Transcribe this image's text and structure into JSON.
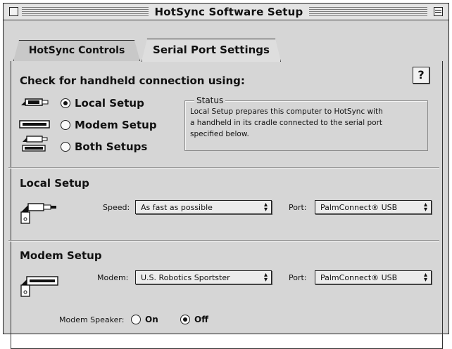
{
  "window": {
    "title": "HotSync Software Setup"
  },
  "tabs": [
    {
      "label": "HotSync Controls"
    },
    {
      "label": "Serial Port Settings"
    }
  ],
  "connection": {
    "heading": "Check for handheld connection using:",
    "help_label": "?",
    "options": [
      {
        "label": "Local Setup",
        "selected": true
      },
      {
        "label": "Modem Setup",
        "selected": false
      },
      {
        "label": "Both Setups",
        "selected": false
      }
    ],
    "status": {
      "title": "Status",
      "line1": "Local Setup prepares this computer to HotSync with",
      "line2": "a handheld in its cradle connected to the serial port",
      "line3": "specified below."
    }
  },
  "local_setup": {
    "heading": "Local Setup",
    "speed_label": "Speed:",
    "speed_value": "As fast as possible",
    "port_label": "Port:",
    "port_value": "PalmConnect® USB"
  },
  "modem_setup": {
    "heading": "Modem Setup",
    "modem_label": "Modem:",
    "modem_value": "U.S. Robotics Sportster",
    "port_label": "Port:",
    "port_value": "PalmConnect® USB",
    "speaker_label": "Modem Speaker:",
    "speaker_options": [
      {
        "label": "On",
        "selected": false
      },
      {
        "label": "Off",
        "selected": true
      }
    ]
  },
  "icons": [
    "close-box-icon",
    "zoom-box-icon",
    "cradle-icon",
    "modem-icon",
    "both-setups-icon",
    "local-cradle-icon",
    "modem-device-icon",
    "popup-arrows-icon"
  ]
}
